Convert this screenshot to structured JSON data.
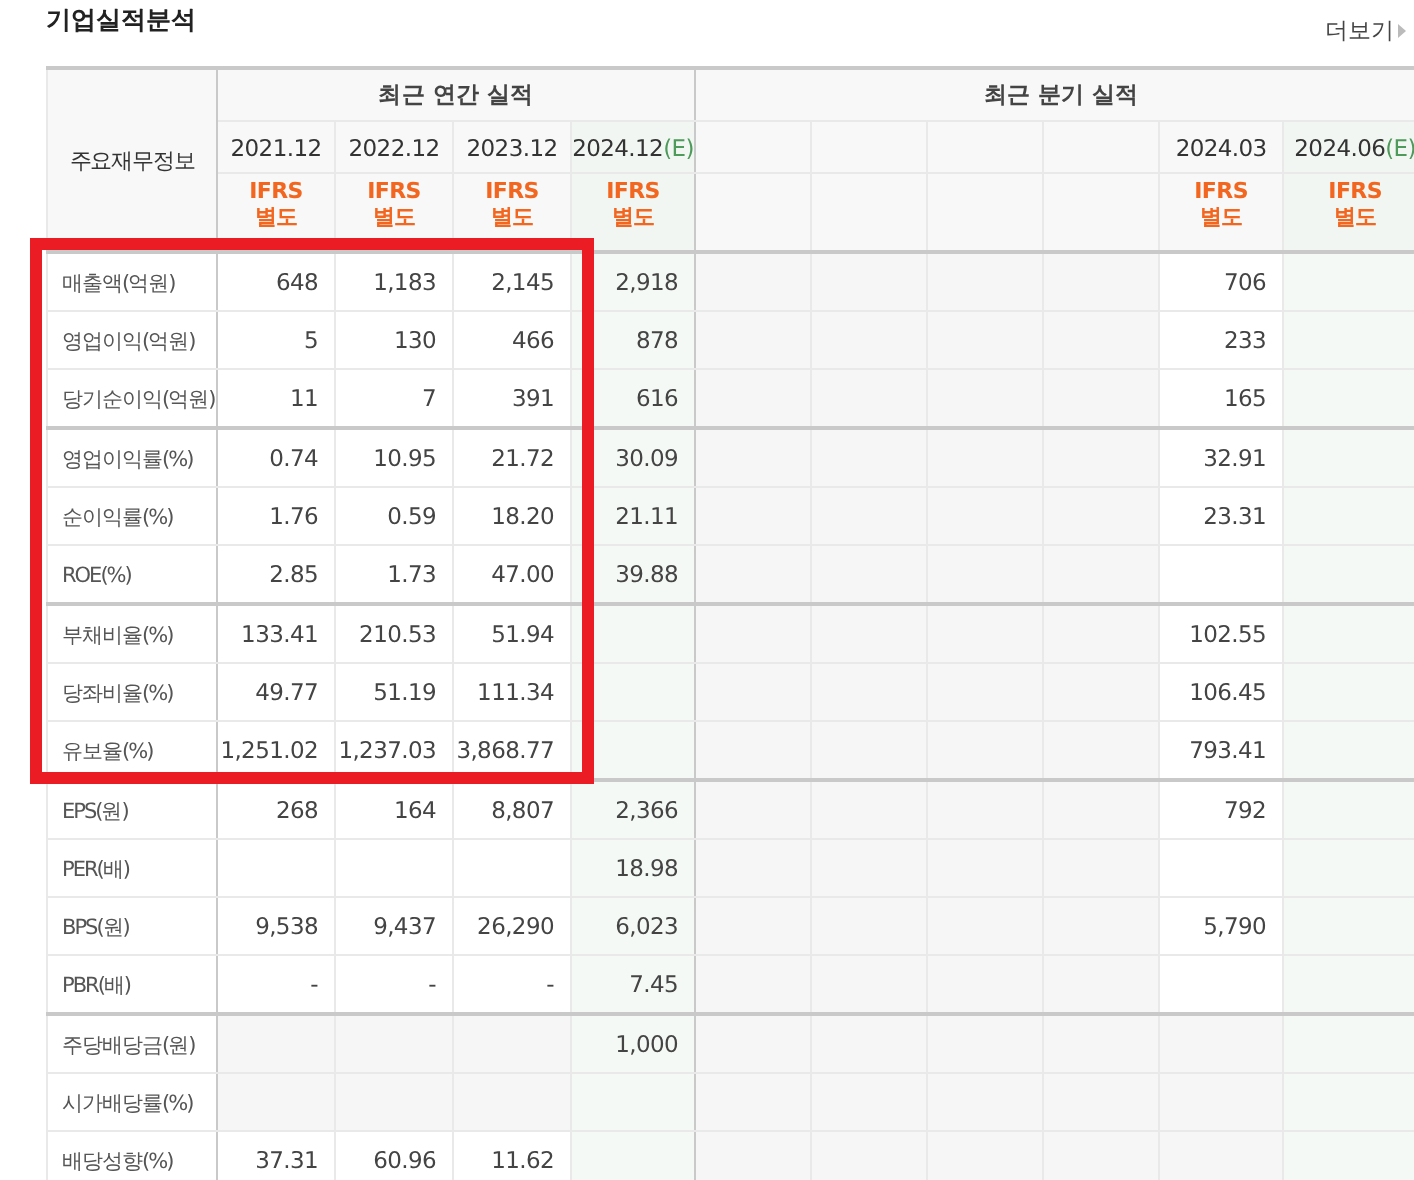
{
  "title": "기업실적분석",
  "more_link": "더보기",
  "stub_header": "주요재무정보",
  "sections": [
    {
      "title": "최근 연간 실적",
      "columns": [
        {
          "kind": "actual",
          "period": "2021.12",
          "basis": "IFRS",
          "scope": "별도"
        },
        {
          "kind": "actual",
          "period": "2022.12",
          "basis": "IFRS",
          "scope": "별도"
        },
        {
          "kind": "actual",
          "period": "2023.12",
          "basis": "IFRS",
          "scope": "별도"
        },
        {
          "kind": "estimate",
          "period": "2024.12",
          "estimate_mark": "(E)",
          "basis": "IFRS",
          "scope": "별도"
        }
      ]
    },
    {
      "title": "최근 분기 실적",
      "columns": [
        {
          "kind": "blank"
        },
        {
          "kind": "blank"
        },
        {
          "kind": "blank"
        },
        {
          "kind": "blank"
        },
        {
          "kind": "actual",
          "period": "2024.03",
          "basis": "IFRS",
          "scope": "별도"
        },
        {
          "kind": "estimate",
          "period": "2024.06",
          "estimate_mark": "(E)",
          "basis": "IFRS",
          "scope": "별도"
        }
      ]
    }
  ],
  "blocks": [
    {
      "kind": "highlighted",
      "row_groups": [
        {
          "kind": "standard",
          "rows": [
            {
              "label": "매출액(억원)",
              "annual": [
                "648",
                "1,183",
                "2,145"
              ],
              "annual_estimate": "2,918",
              "quarter": "706"
            },
            {
              "label": "영업이익(억원)",
              "annual": [
                "5",
                "130",
                "466"
              ],
              "annual_estimate": "878",
              "quarter": "233"
            },
            {
              "label": "당기순이익(억원)",
              "annual": [
                "11",
                "7",
                "391"
              ],
              "annual_estimate": "616",
              "quarter": "165"
            }
          ]
        },
        {
          "kind": "standard",
          "rows": [
            {
              "label": "영업이익률(%)",
              "annual": [
                "0.74",
                "10.95",
                "21.72"
              ],
              "annual_estimate": "30.09",
              "quarter": "32.91"
            },
            {
              "label": "순이익률(%)",
              "annual": [
                "1.76",
                "0.59",
                "18.20"
              ],
              "annual_estimate": "21.11",
              "quarter": "23.31"
            },
            {
              "label": "ROE(%)",
              "annual": [
                "2.85",
                "1.73",
                "47.00"
              ],
              "annual_estimate": "39.88"
            }
          ]
        },
        {
          "kind": "standard",
          "rows": [
            {
              "label": "부채비율(%)",
              "annual": [
                "133.41",
                "210.53",
                "51.94"
              ],
              "quarter": "102.55"
            },
            {
              "label": "당좌비율(%)",
              "annual": [
                "49.77",
                "51.19",
                "111.34"
              ],
              "quarter": "106.45"
            },
            {
              "label": "유보율(%)",
              "annual": [
                "1,251.02",
                "1,237.03",
                "3,868.77"
              ],
              "quarter": "793.41"
            }
          ]
        }
      ]
    },
    {
      "kind": "plain",
      "row_groups": [
        {
          "kind": "standard",
          "rows": [
            {
              "label": "EPS(원)",
              "annual": [
                "268",
                "164",
                "8,807"
              ],
              "annual_estimate": "2,366",
              "quarter": "792"
            },
            {
              "label": "PER(배)",
              "annual_estimate": "18.98"
            },
            {
              "label": "BPS(원)",
              "annual": [
                "9,538",
                "9,437",
                "26,290"
              ],
              "annual_estimate": "6,023",
              "quarter": "5,790"
            },
            {
              "label": "PBR(배)",
              "annual": [
                "-",
                "-",
                "-"
              ],
              "annual_estimate": "7.45"
            }
          ]
        },
        {
          "kind": "dividend",
          "rows": [
            {
              "label": "주당배당금(원)",
              "annual_estimate": "1,000"
            },
            {
              "label": "시가배당률(%)"
            },
            {
              "label": "배당성향(%)",
              "annual": [
                "37.31",
                "60.96",
                "11.62"
              ]
            }
          ]
        }
      ]
    }
  ]
}
